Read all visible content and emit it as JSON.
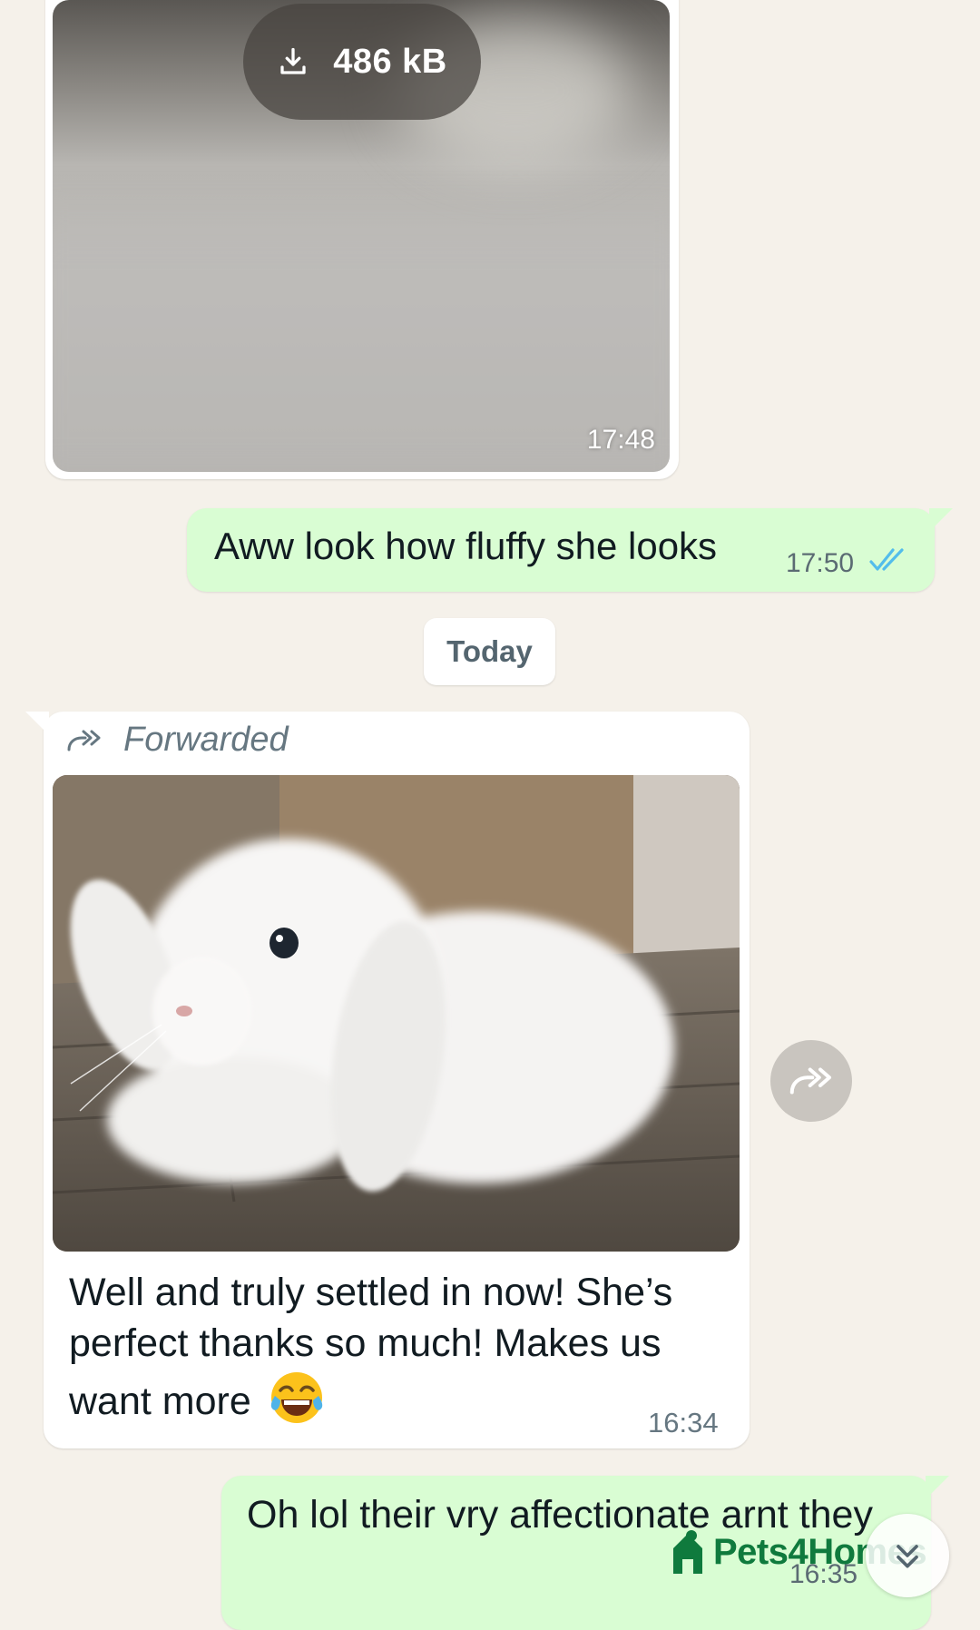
{
  "messages": {
    "media_top": {
      "download_size": "486 kB",
      "time": "17:48"
    },
    "outgoing_1": {
      "text": "Aww look how fluffy she looks",
      "time": "17:50",
      "status_icon": "double-check-read-icon"
    },
    "date_divider": "Today",
    "forwarded": {
      "label": "Forwarded",
      "caption": "Well and truly settled in now! She’s perfect thanks so much! Makes us want more",
      "emoji": "😂",
      "time": "16:34"
    },
    "outgoing_2": {
      "text": "Oh lol their vry affectionate arnt they",
      "time": "16:35"
    }
  },
  "watermark": "Pets4Homes",
  "colors": {
    "chat_background": "#f5f1ea",
    "outgoing_bubble": "#d9fdd3",
    "incoming_bubble": "#ffffff",
    "read_tick": "#53bdeb",
    "watermark_green": "#0f7a3d"
  }
}
